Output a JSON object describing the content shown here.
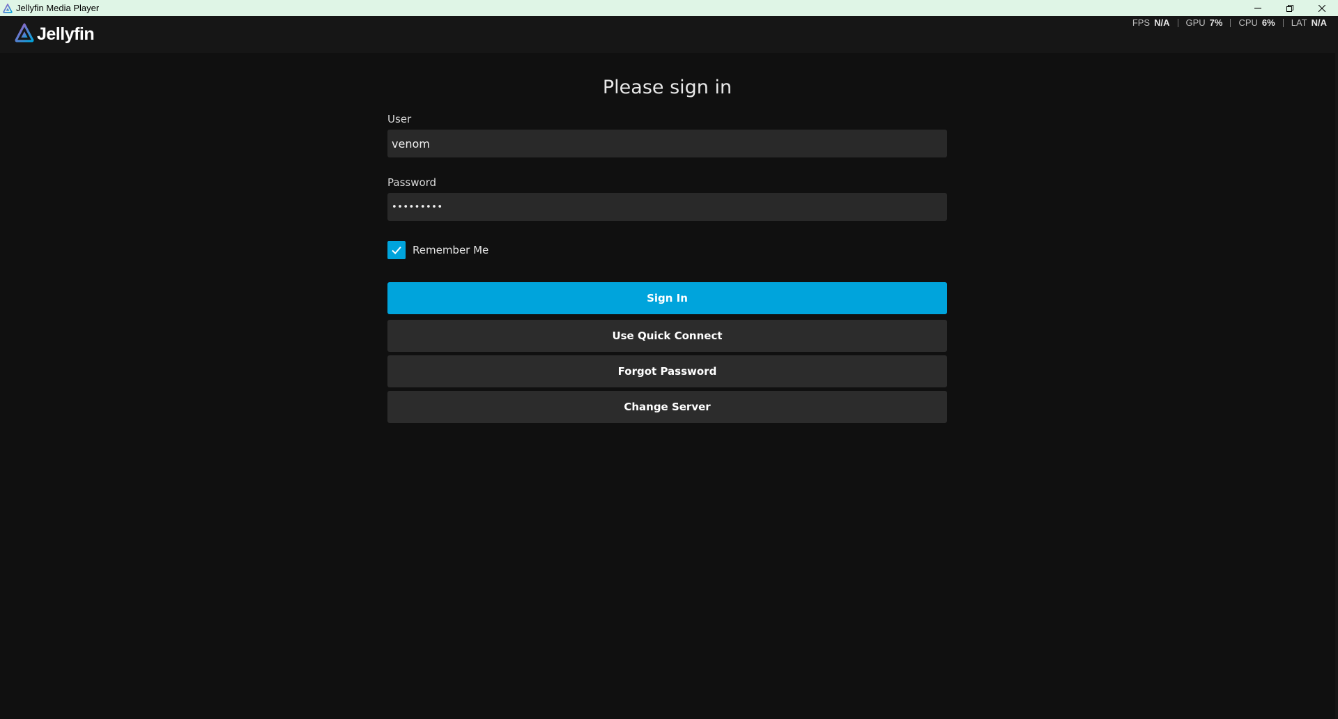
{
  "window": {
    "title": "Jellyfin Media Player",
    "controls": {
      "minimize": "minimize-icon",
      "maximize": "restore-icon",
      "close": "close-icon"
    }
  },
  "header": {
    "logo_text": "Jellyfin",
    "stats": [
      {
        "label": "FPS",
        "value": "N/A"
      },
      {
        "label": "GPU",
        "value": "7%"
      },
      {
        "label": "CPU",
        "value": "6%"
      },
      {
        "label": "LAT",
        "value": "N/A"
      }
    ]
  },
  "login": {
    "title": "Please sign in",
    "user_label": "User",
    "user_value": "venom",
    "password_label": "Password",
    "password_value": "•••••••••",
    "remember_label": "Remember Me",
    "remember_checked": true,
    "sign_in_label": "Sign In",
    "quick_connect_label": "Use Quick Connect",
    "forgot_password_label": "Forgot Password",
    "change_server_label": "Change Server"
  },
  "colors": {
    "accent": "#00a4dc",
    "background": "#101010",
    "header": "#161616",
    "input": "#292929",
    "secondary_button": "#2c2c2c"
  }
}
